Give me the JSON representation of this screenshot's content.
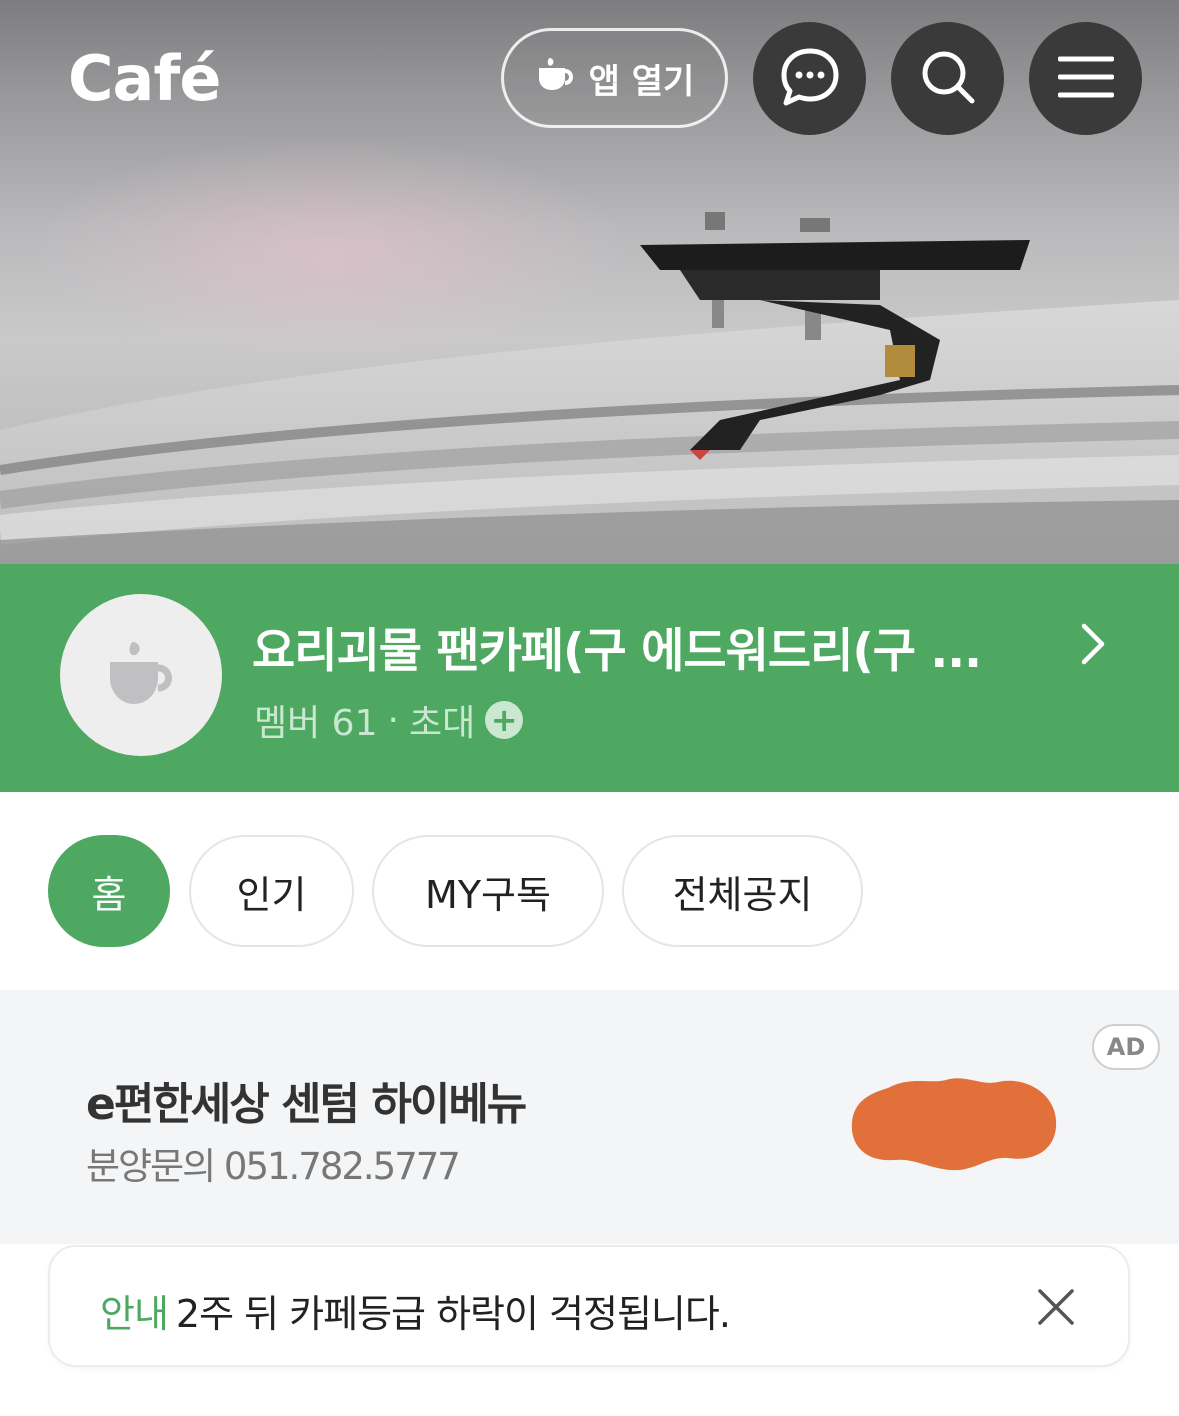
{
  "header": {
    "logo": "Café",
    "app_open_label": "앱 열기",
    "icons": {
      "app_open": "coffee-cup-icon",
      "chat": "chat-bubble-icon",
      "search": "search-icon",
      "menu": "hamburger-menu-icon"
    }
  },
  "cafe": {
    "name": "요리괴물 팬카페(구 에드워드리(구 ...",
    "members_label": "멤버 61",
    "separator": "·",
    "invite_label": "초대",
    "invite_icon": "+",
    "icons": {
      "avatar": "coffee-cup-icon",
      "arrow": "chevron-right-icon"
    },
    "brand_color": "#4ea862"
  },
  "tabs": [
    {
      "label": "홈",
      "active": true
    },
    {
      "label": "인기",
      "active": false
    },
    {
      "label": "MY구독",
      "active": false
    },
    {
      "label": "전체공지",
      "active": false
    }
  ],
  "ad": {
    "badge": "AD",
    "title": "e편한세상 센텀 하이베뉴",
    "subtitle": "분양문의 051.782.5777",
    "blob_color": "#e1703a"
  },
  "notice": {
    "label": "안내",
    "text": "2주 뒤 카페등급 하락이 걱정됩니다.",
    "close_icon": "close-icon"
  }
}
